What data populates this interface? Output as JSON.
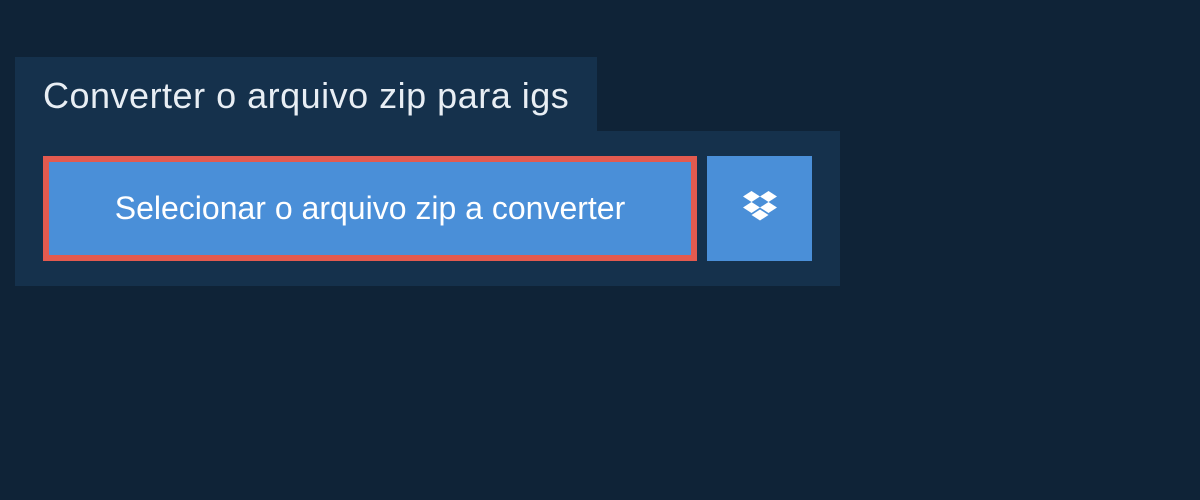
{
  "header": {
    "title": "Converter o arquivo zip para igs"
  },
  "main": {
    "select_button_label": "Selecionar o arquivo zip a converter"
  },
  "colors": {
    "page_bg": "#0f2337",
    "panel_bg": "#15314c",
    "button_bg": "#4a8fd8",
    "highlight_border": "#e35a4f",
    "text_light": "#e8eef4",
    "text_white": "#ffffff"
  }
}
